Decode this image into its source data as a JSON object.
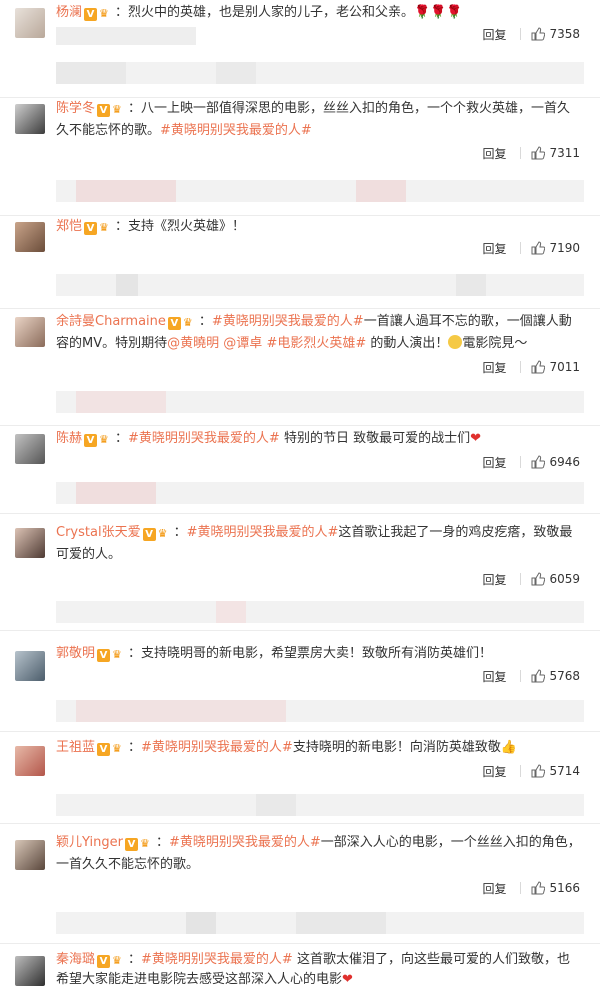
{
  "actions": {
    "reply_label": "回复"
  },
  "comments": [
    {
      "name": "杨澜",
      "body": "：烈火中的英雄，也是别人家的儿子，老公和父亲。",
      "tail": "🌹🌹🌹",
      "likes": "7358"
    },
    {
      "name": "陈学冬",
      "body": "：八一上映一部值得深思的电影，丝丝入扣的角色，一个个救火英雄，一首久久不能忘怀的歌。",
      "tag": "#黄晓明别哭我最爱的人#",
      "likes": "7311"
    },
    {
      "name": "郑恺",
      "body": "：支持《烈火英雄》！",
      "likes": "7190"
    },
    {
      "name": "余詩曼Charmaine",
      "tag": "#黄晓明别哭我最爱的人#",
      "body": "一首讓人過耳不忘的歌，一個讓人動容的MV。特別期待",
      "m1": "@黄曉明",
      "m2": "@谭卓",
      "tag2": "#电影烈火英雄#",
      "body2": "的動人演出！",
      "body3": "電影院見～",
      "likes": "7011"
    },
    {
      "name": "陈赫",
      "tag": "#黄晓明别哭我最爱的人#",
      "body": " 特别的节日 致敬最可爱的战士们",
      "likes": "6946"
    },
    {
      "name": "Crystal张天爱",
      "tag": "#黄晓明别哭我最爱的人#",
      "body": "这首歌让我起了一身的鸡皮疙瘩，致敬最可爱的人。",
      "likes": "6059"
    },
    {
      "name": "郭敬明",
      "body": "：支持晓明哥的新电影，希望票房大卖！致敬所有消防英雄们！",
      "likes": "5768"
    },
    {
      "name": "王祖蓝",
      "tag": "#黄晓明别哭我最爱的人#",
      "body": "支持晓明的新电影！向消防英雄致敬",
      "likes": "5714"
    },
    {
      "name": "颖儿Yinger",
      "tag": "#黄晓明别哭我最爱的人#",
      "body": "一部深入人心的电影，一个丝丝入扣的角色，一首久久不能忘怀的歌。",
      "likes": "5166"
    },
    {
      "name": "秦海璐",
      "tag": "#黄晓明别哭我最爱的人#",
      "body": " 这首歌太催泪了，向这些最可爱的人们致敬，也希望大家能走进电影院去感受这部深入人心的电影",
      "likes": ""
    }
  ]
}
